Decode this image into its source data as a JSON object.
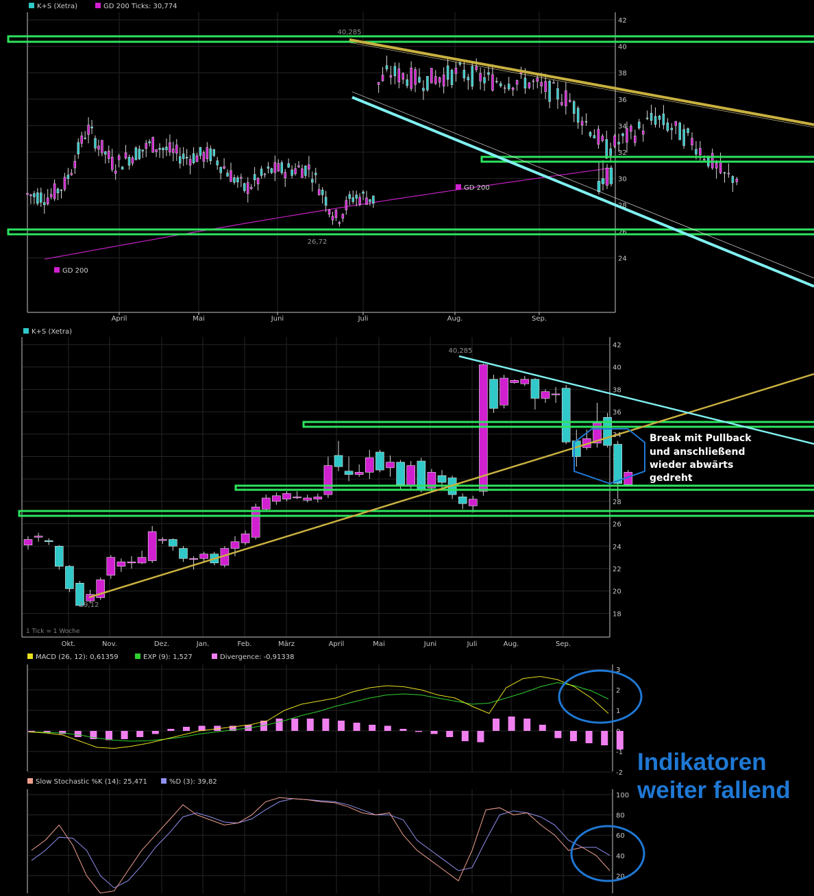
{
  "colors": {
    "bull": "#d020d0",
    "bear": "#30c8c8",
    "ma": "#c020c0",
    "wick": "#d8d8d8",
    "grid": "#262626",
    "axis": "#c8c8c8",
    "hline": "#2de35e",
    "upper": "#c8b040",
    "lower": "#80f0f0",
    "macd": "#e8e020",
    "exp": "#30d030",
    "hist": "#f080f0",
    "stochK": "#f0a090",
    "stochD": "#9090f0",
    "circle": "#1f78d4"
  },
  "chart_data": [
    {
      "type": "candlestick",
      "legend": [
        {
          "label": "K+S (Xetra)",
          "color": "#30c8c8"
        },
        {
          "label": "GD 200 Ticks: 30,774",
          "color": "#d020d0"
        }
      ],
      "x_labels": [
        "April",
        "Mai",
        "Juni",
        "Juli",
        "Aug.",
        "Sep."
      ],
      "y_ticks": [
        "42",
        "40",
        "38",
        "36",
        "34",
        "32",
        "30",
        "28",
        "26",
        "24"
      ],
      "ylim": [
        22.5,
        42
      ],
      "annotations": [
        {
          "text": "40,285",
          "x": 129,
          "y": 40.285
        },
        {
          "text": "26,72",
          "x": 114,
          "y": 26.72
        },
        {
          "text": "GD 200",
          "x": 160,
          "y": 29.4
        },
        {
          "text": "GD 200",
          "x": 10,
          "y": 23.6
        }
      ],
      "period_count": 240,
      "trend_start": {
        "index": 56,
        "value": 28.6
      },
      "trend_low": 26.6,
      "trend_end": 30.8,
      "horizontal_levels": [
        40.2,
        26.8,
        31.2
      ],
      "trendlines": [
        {
          "name": "upper",
          "from": [
            130,
            40.3
          ],
          "to": [
            240,
            35
          ]
        },
        {
          "name": "lower",
          "from": [
            130,
            35.5
          ],
          "to": [
            240,
            28.2
          ]
        }
      ],
      "last_candles": [
        {
          "o": 29.8,
          "c": 29.0,
          "h": 31.3,
          "l": 28.8
        },
        {
          "o": 30.0,
          "c": 29.6,
          "h": 31.4,
          "l": 29.1
        },
        {
          "o": 29.5,
          "c": 30.8,
          "h": 31.1,
          "l": 29.2
        },
        {
          "o": 30.8,
          "c": 29.6,
          "h": 31.0,
          "l": 29.4
        }
      ]
    },
    {
      "type": "candlestick",
      "legend": [
        {
          "label": "K+S (Xetra)",
          "color": "#30c8c8"
        }
      ],
      "x_labels": [
        "Okt.",
        "Nov.",
        "Dez.",
        "Jan.",
        "Feb.",
        "März",
        "April",
        "Mai",
        "Juni",
        "Juli",
        "Aug.",
        "Sep."
      ],
      "y_ticks": [
        "42",
        "40",
        "38",
        "36",
        "34",
        "32",
        "30",
        "28",
        "26",
        "24",
        "22",
        "20",
        "18"
      ],
      "ylim": [
        17.5,
        42
      ],
      "annotations": [
        {
          "text": "40,285",
          "x": 43,
          "y": 40.285
        },
        {
          "text": "19,12",
          "x": 6,
          "y": 19.12
        }
      ],
      "note": "1 Tick = 1 Woche",
      "callout": [
        "Break mit Pullback",
        "und anschließend",
        "wieder abwärts",
        "gedreht"
      ],
      "horizontal_levels": [
        32.5,
        27,
        25
      ],
      "trendlines": [
        {
          "name": "support",
          "from": [
            7,
            19.12
          ],
          "to": [
            63,
            38.5
          ]
        },
        {
          "name": "resistance",
          "from": [
            43,
            40.4
          ],
          "to": [
            63,
            30.4
          ]
        }
      ],
      "candles": [
        [
          24.1,
          24.6,
          24.9,
          23.7
        ],
        [
          24.8,
          24.9,
          25.2,
          24.4
        ],
        [
          24.5,
          24.4,
          24.7,
          24.1
        ],
        [
          24.0,
          22.2,
          24.1,
          21.9
        ],
        [
          22.2,
          20.2,
          22.3,
          19.9
        ],
        [
          20.7,
          18.7,
          20.9,
          18.6
        ],
        [
          19.1,
          19.7,
          20.1,
          18.9
        ],
        [
          19.4,
          21.0,
          21.2,
          19.2
        ],
        [
          21.4,
          23.0,
          23.2,
          21.1
        ],
        [
          22.2,
          22.6,
          22.9,
          21.7
        ],
        [
          22.5,
          22.6,
          23.1,
          22.0
        ],
        [
          22.5,
          23.0,
          23.6,
          22.4
        ],
        [
          22.7,
          25.3,
          25.8,
          22.5
        ],
        [
          24.5,
          24.6,
          24.8,
          24.2
        ],
        [
          24.6,
          24.0,
          24.7,
          23.6
        ],
        [
          23.8,
          22.9,
          24.0,
          22.6
        ],
        [
          22.9,
          22.9,
          23.1,
          21.9
        ],
        [
          22.9,
          23.3,
          23.5,
          22.6
        ],
        [
          23.3,
          22.5,
          23.5,
          22.3
        ],
        [
          22.3,
          23.8,
          24.0,
          22.1
        ],
        [
          23.8,
          24.4,
          24.9,
          23.1
        ],
        [
          24.3,
          25.1,
          25.4,
          24.1
        ],
        [
          24.8,
          27.5,
          27.8,
          24.6
        ],
        [
          27.3,
          28.3,
          28.6,
          27.1
        ],
        [
          28.0,
          28.5,
          28.8,
          27.7
        ],
        [
          28.2,
          28.7,
          28.9,
          28.0
        ],
        [
          28.4,
          28.4,
          28.9,
          28.2
        ],
        [
          28.1,
          28.3,
          28.6,
          27.9
        ],
        [
          28.2,
          28.4,
          28.7,
          27.9
        ],
        [
          28.6,
          31.2,
          32.0,
          28.3
        ],
        [
          32.1,
          31.1,
          33.4,
          30.7
        ],
        [
          30.7,
          30.4,
          32.0,
          29.8
        ],
        [
          30.4,
          30.6,
          31.3,
          30.2
        ],
        [
          30.6,
          31.9,
          32.6,
          30.0
        ],
        [
          32.4,
          30.8,
          32.6,
          30.6
        ],
        [
          31.0,
          31.5,
          32.1,
          30.2
        ],
        [
          31.5,
          29.5,
          31.7,
          29.0
        ],
        [
          29.4,
          31.2,
          31.6,
          29.1
        ],
        [
          31.6,
          29.0,
          31.9,
          28.8
        ],
        [
          29.2,
          30.6,
          30.9,
          28.9
        ],
        [
          30.3,
          29.7,
          30.8,
          29.2
        ],
        [
          30.1,
          28.6,
          30.3,
          28.2
        ],
        [
          28.4,
          27.8,
          28.7,
          27.3
        ],
        [
          27.6,
          28.2,
          28.5,
          27.0
        ],
        [
          28.9,
          40.2,
          40.3,
          28.5
        ],
        [
          38.9,
          36.3,
          39.3,
          35.9
        ],
        [
          36.6,
          39.0,
          39.3,
          36.3
        ],
        [
          38.6,
          38.8,
          38.9,
          38.5
        ],
        [
          38.5,
          38.9,
          39.2,
          38.3
        ],
        [
          38.9,
          37.2,
          39.0,
          36.2
        ],
        [
          37.2,
          37.8,
          38.0,
          36.8
        ],
        [
          37.6,
          37.6,
          38.2,
          36.8
        ],
        [
          38.1,
          33.3,
          38.4,
          33.1
        ],
        [
          33.4,
          32.0,
          34.4,
          31.1
        ],
        [
          32.8,
          33.6,
          34.4,
          32.6
        ],
        [
          33.2,
          35.0,
          36.8,
          32.8
        ],
        [
          35.5,
          33.0,
          35.9,
          32.8
        ],
        [
          33.1,
          29.6,
          33.4,
          28.2
        ],
        [
          29.5,
          30.6,
          30.8,
          29.3
        ]
      ]
    },
    {
      "type": "line",
      "legend": [
        {
          "label": "MACD (26, 12): 0,61359",
          "color": "#e8e020"
        },
        {
          "label": "EXP (9): 1,527",
          "color": "#30d030"
        },
        {
          "label": "Divergence: -0,91338",
          "color": "#f080f0"
        }
      ],
      "y_ticks": [
        "3",
        "2",
        "1",
        "0",
        "-1",
        "-2"
      ],
      "ylim": [
        -2,
        3
      ],
      "series": [
        {
          "values": [
            -0.05,
            -0.1,
            -0.2,
            -0.5,
            -0.8,
            -0.85,
            -0.75,
            -0.6,
            -0.4,
            -0.2,
            0.0,
            0.1,
            0.2,
            0.3,
            0.5,
            1.0,
            1.3,
            1.45,
            1.6,
            1.9,
            2.1,
            2.2,
            2.15,
            2.0,
            1.75,
            1.6,
            1.2,
            0.85,
            2.1,
            2.55,
            2.65,
            2.5,
            2.15,
            1.6,
            0.85
          ]
        },
        {
          "values": [
            -0.05,
            -0.07,
            -0.1,
            -0.2,
            -0.35,
            -0.45,
            -0.5,
            -0.48,
            -0.4,
            -0.3,
            -0.15,
            -0.05,
            0.05,
            0.15,
            0.3,
            0.5,
            0.75,
            0.95,
            1.2,
            1.4,
            1.6,
            1.75,
            1.8,
            1.75,
            1.6,
            1.45,
            1.3,
            1.35,
            1.6,
            1.85,
            2.15,
            2.35,
            2.2,
            1.95,
            1.55
          ]
        },
        {
          "values": [
            -0.05,
            -0.1,
            -0.15,
            -0.3,
            -0.4,
            -0.45,
            -0.4,
            -0.3,
            -0.15,
            0.1,
            0.2,
            0.25,
            0.25,
            0.25,
            0.3,
            0.5,
            0.6,
            0.6,
            0.6,
            0.6,
            0.5,
            0.4,
            0.3,
            0.25,
            0.1,
            -0.05,
            -0.15,
            -0.3,
            -0.5,
            -0.55,
            0.6,
            0.7,
            0.6,
            0.3,
            -0.35,
            -0.5,
            -0.6,
            -0.7,
            -0.9
          ]
        }
      ]
    },
    {
      "type": "line",
      "legend": [
        {
          "label": "Slow Stochastic %K (14): 25,471",
          "color": "#f0a090"
        },
        {
          "label": "%D (3): 39,82",
          "color": "#9090f0"
        }
      ],
      "y_ticks": [
        "100",
        "80",
        "60",
        "40",
        "20"
      ],
      "ylim": [
        0,
        105
      ],
      "series": [
        {
          "values": [
            45,
            55,
            70,
            50,
            20,
            3,
            5,
            25,
            45,
            60,
            75,
            90,
            80,
            75,
            70,
            72,
            80,
            93,
            97,
            96,
            95,
            93,
            92,
            88,
            82,
            80,
            82,
            60,
            45,
            35,
            25,
            15,
            45,
            85,
            87,
            80,
            82,
            70,
            60,
            45,
            48,
            40,
            25
          ]
        },
        {
          "values": [
            35,
            45,
            58,
            57,
            45,
            20,
            8,
            15,
            30,
            48,
            62,
            78,
            82,
            78,
            73,
            72,
            76,
            85,
            93,
            96,
            95,
            94,
            93,
            90,
            85,
            80,
            80,
            75,
            55,
            45,
            35,
            25,
            28,
            55,
            80,
            84,
            82,
            78,
            70,
            55,
            48,
            48,
            40
          ]
        }
      ]
    }
  ]
}
